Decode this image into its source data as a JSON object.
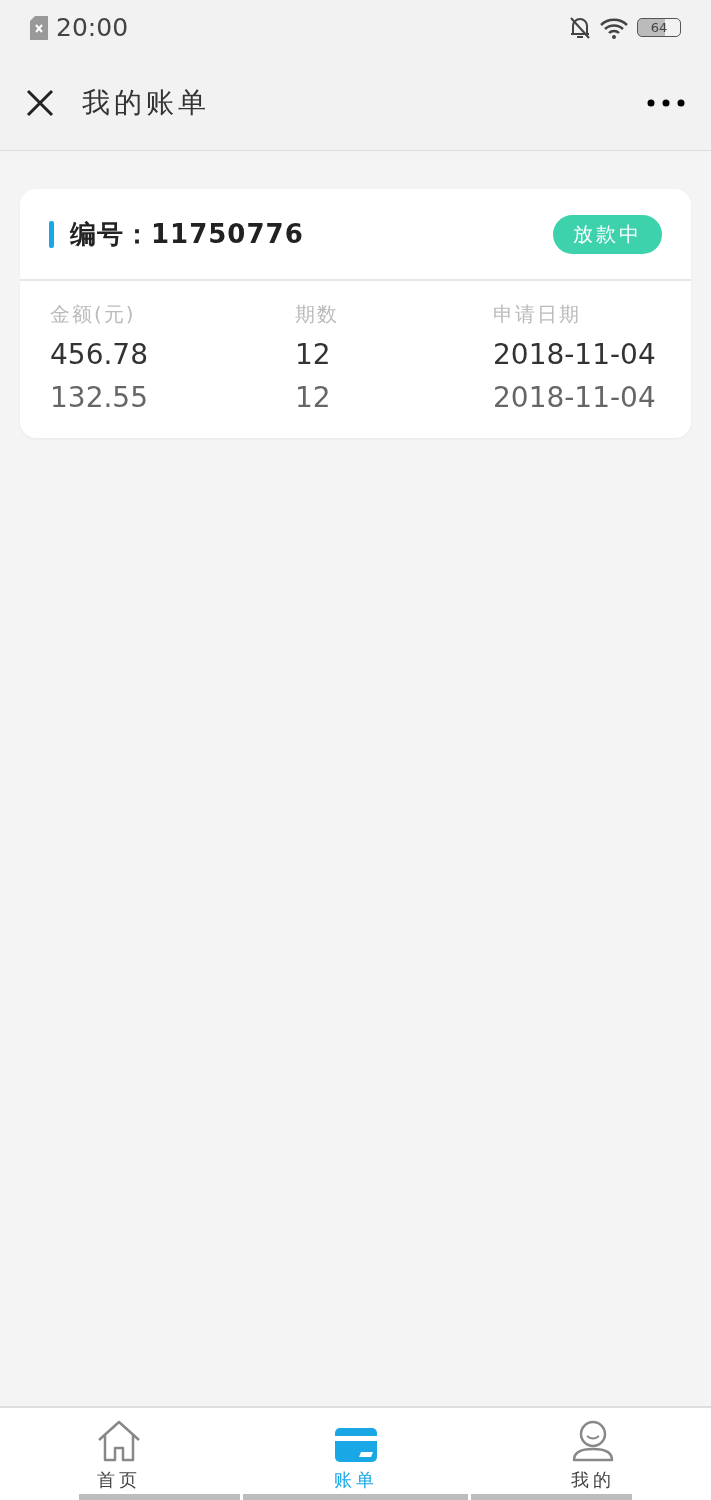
{
  "status_bar": {
    "time": "20:00",
    "battery": "64"
  },
  "header": {
    "title": "我的账单"
  },
  "bill": {
    "number": "编号：11750776",
    "status": "放款中",
    "columns": [
      "金额(元)",
      "期数",
      "申请日期"
    ],
    "rows": [
      {
        "emphasized": true,
        "cells": [
          "456.78",
          "12",
          "2018-11-04"
        ]
      },
      {
        "emphasized": false,
        "cells": [
          "132.55",
          "12",
          "2018-11-04"
        ]
      }
    ]
  },
  "tab_bar": [
    {
      "kind": "home",
      "label": "首页",
      "selected": false
    },
    {
      "kind": "card",
      "label": "账单",
      "selected": true
    },
    {
      "kind": "person",
      "label": "我的",
      "selected": false
    }
  ]
}
